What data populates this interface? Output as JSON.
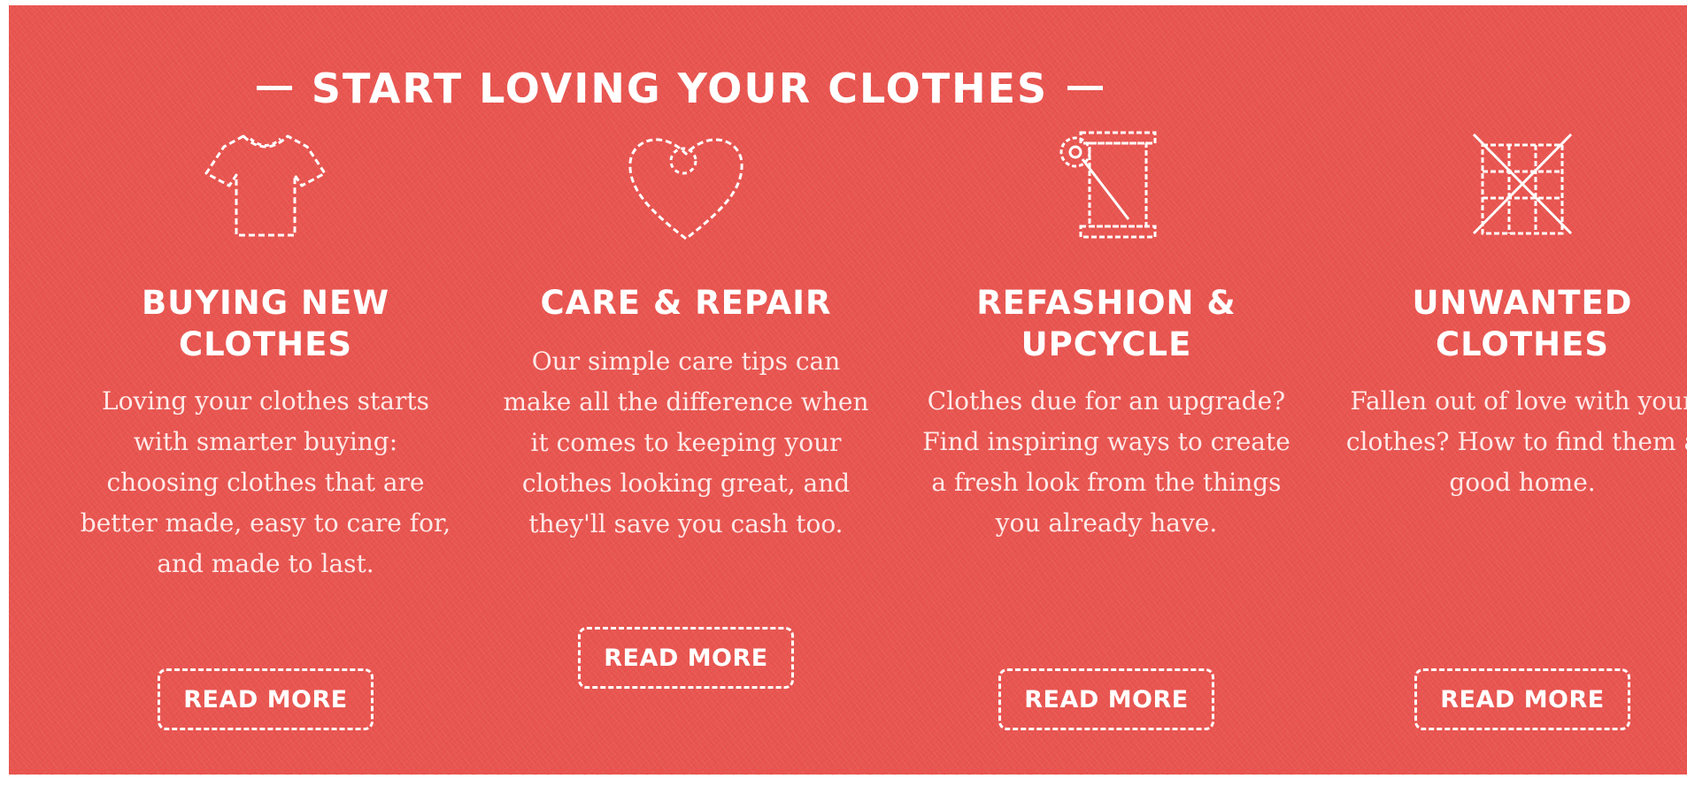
{
  "section": {
    "title": "START LOVING YOUR CLOTHES"
  },
  "colors": {
    "background": "#e9544f",
    "text": "#ffffff"
  },
  "cards": [
    {
      "icon": "t-shirt-icon",
      "title": "BUYING NEW CLOTHES",
      "body": "Loving your clothes starts with smarter buying: choosing clothes that are better made, easy to care for, and made to last.",
      "button": "READ MORE"
    },
    {
      "icon": "heart-icon",
      "title": "CARE & REPAIR",
      "body": "Our simple care tips can make all the difference when it comes to keeping your clothes looking great, and they'll save you cash too.",
      "button": "READ MORE"
    },
    {
      "icon": "thread-spool-icon",
      "title": "REFASHION & UPCYCLE",
      "body": "Clothes due for an upgrade? Find inspiring ways to create a fresh look from the things you already have.",
      "button": "READ MORE"
    },
    {
      "icon": "crossed-out-basket-icon",
      "title": "UNWANTED CLOTHES",
      "body": "Fallen out of love with your clothes? How to find them a good home.",
      "button": "READ MORE"
    }
  ]
}
